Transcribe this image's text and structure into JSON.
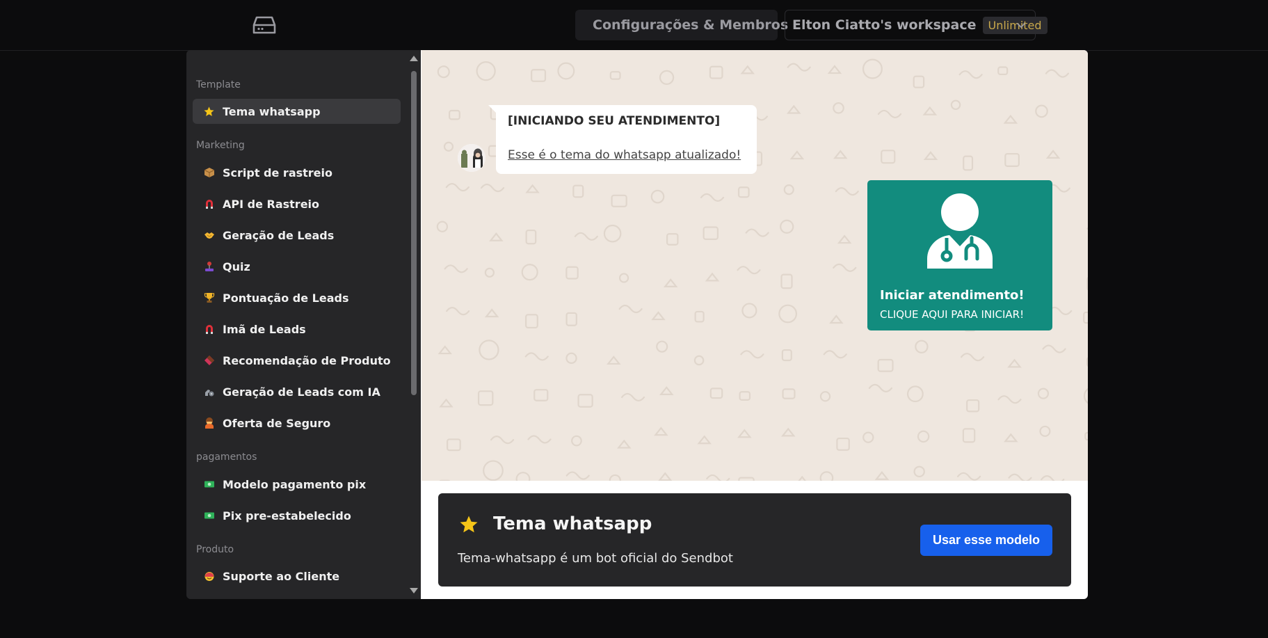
{
  "header": {
    "logo_icon": "inbox-tray-icon",
    "settings_icon": "gear-icon",
    "settings_label": "Configurações & Membros",
    "workspace_name": "Elton Ciatto's workspace",
    "plan_badge": "Unlimited",
    "workspace_chevron_icon": "chevron-down-icon"
  },
  "sidebar": {
    "groups": [
      {
        "label": "Template",
        "items": [
          {
            "label": "Tema whatsapp",
            "icon": "star-icon",
            "active": true
          }
        ]
      },
      {
        "label": "Marketing",
        "items": [
          {
            "label": "Script de rastreio",
            "icon": "package-icon"
          },
          {
            "label": "API de Rastreio",
            "icon": "magnet-icon"
          },
          {
            "label": "Geração de Leads",
            "icon": "handshake-icon"
          },
          {
            "label": "Quiz",
            "icon": "joystick-icon"
          },
          {
            "label": "Pontuação de Leads",
            "icon": "trophy-icon"
          },
          {
            "label": "Imã de Leads",
            "icon": "magnet-icon"
          },
          {
            "label": "Recomendação de Produto",
            "icon": "chocolate-bar-icon"
          },
          {
            "label": "Geração de Leads com IA",
            "icon": "mechanical-arm-icon"
          },
          {
            "label": "Oferta de Seguro",
            "icon": "person-gesturing-ok-icon"
          }
        ]
      },
      {
        "label": "pagamentos",
        "items": [
          {
            "label": "Modelo pagamento pix",
            "icon": "money-icon"
          },
          {
            "label": "Pix pre-estabelecido",
            "icon": "money-icon"
          }
        ]
      },
      {
        "label": "Produto",
        "items": [
          {
            "label": "Suporte ao Cliente",
            "icon": "smiling-face-icon"
          }
        ]
      }
    ]
  },
  "preview": {
    "bot_message_title": "[INICIANDO SEU ATENDIMENTO]",
    "bot_message_link": "Esse é o tema do whatsapp atualizado!",
    "cta_icon": "doctor-icon",
    "cta_title": "Iniciar atendimento!",
    "cta_subtitle": "CLIQUE AQUI PARA INICIAR!"
  },
  "template_info": {
    "icon": "star-icon",
    "title": "Tema whatsapp",
    "description": "Tema-whatsapp é um bot oficial do Sendbot",
    "use_button": "Usar esse modelo"
  },
  "colors": {
    "whatsapp_green": "#128c7e",
    "primary_button": "#1760ec",
    "plan_badge_text": "#c9a94b",
    "chat_background": "#efe7df"
  }
}
